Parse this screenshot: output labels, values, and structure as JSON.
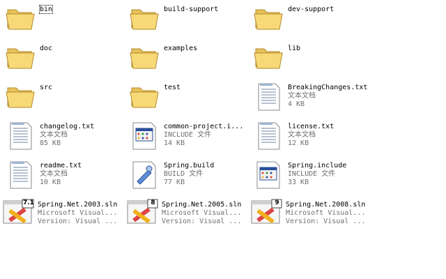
{
  "items": [
    {
      "name": "bin",
      "icon": "folder-icon",
      "selected": true
    },
    {
      "name": "build-support",
      "icon": "folder-icon"
    },
    {
      "name": "dev-support",
      "icon": "folder-icon"
    },
    {
      "name": "doc",
      "icon": "folder-icon"
    },
    {
      "name": "examples",
      "icon": "folder-icon"
    },
    {
      "name": "lib",
      "icon": "folder-icon"
    },
    {
      "name": "src",
      "icon": "folder-icon"
    },
    {
      "name": "test",
      "icon": "folder-icon"
    },
    {
      "name": "BreakingChanges.txt",
      "type": "文本文档",
      "size": "4 KB",
      "icon": "text-document-icon"
    },
    {
      "name": "changelog.txt",
      "type": "文本文档",
      "size": "85 KB",
      "icon": "text-document-icon"
    },
    {
      "name": "common-project.i...",
      "type": "INCLUDE 文件",
      "size": "14 KB",
      "icon": "window-file-icon"
    },
    {
      "name": "license.txt",
      "type": "文本文档",
      "size": "12 KB",
      "icon": "text-document-icon"
    },
    {
      "name": "readme.txt",
      "type": "文本文档",
      "size": "10 KB",
      "icon": "text-document-icon"
    },
    {
      "name": "Spring.build",
      "type": "BUILD 文件",
      "size": "77 KB",
      "icon": "build-file-icon"
    },
    {
      "name": "Spring.include",
      "type": "INCLUDE 文件",
      "size": "33 KB",
      "icon": "window-file-icon"
    },
    {
      "name": "Spring.Net.2003.sln",
      "type": "Microsoft Visual...",
      "size": "Version: Visual ...",
      "icon": "visual-studio-solution-icon",
      "badge": "7.1"
    },
    {
      "name": "Spring.Net.2005.sln",
      "type": "Microsoft Visual...",
      "size": "Version: Visual ...",
      "icon": "visual-studio-solution-icon",
      "badge": "8"
    },
    {
      "name": "Spring.Net.2008.sln",
      "type": "Microsoft Visual...",
      "size": "Version: Visual ...",
      "icon": "visual-studio-solution-icon",
      "badge": "9"
    }
  ]
}
